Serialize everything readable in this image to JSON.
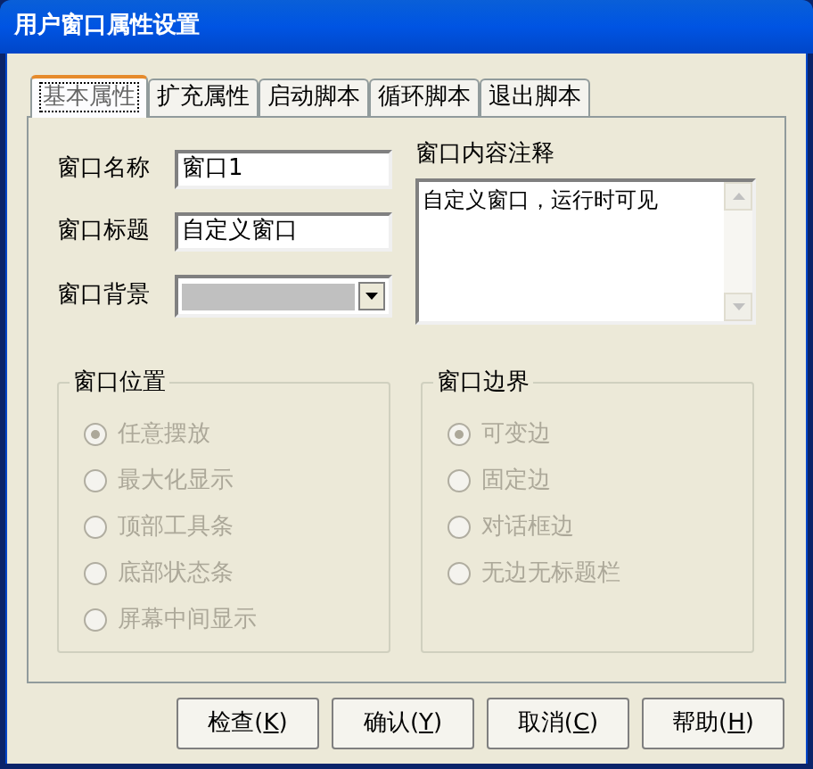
{
  "window": {
    "title": "用户窗口属性设置"
  },
  "tabs": [
    {
      "label": "基本属性",
      "selected": true
    },
    {
      "label": "扩充属性",
      "selected": false
    },
    {
      "label": "启动脚本",
      "selected": false
    },
    {
      "label": "循环脚本",
      "selected": false
    },
    {
      "label": "退出脚本",
      "selected": false
    }
  ],
  "fields": [
    {
      "label": "窗口名称",
      "kind": "text",
      "value": "窗口1"
    },
    {
      "label": "窗口标题",
      "kind": "text",
      "value": "自定义窗口"
    },
    {
      "label": "窗口背景",
      "kind": "color",
      "color": "#c0c0c0"
    }
  ],
  "comment": {
    "label": "窗口内容注释",
    "value": "自定义窗口，运行时可见"
  },
  "groups": [
    {
      "title": "窗口位置",
      "disabled": true,
      "options": [
        {
          "label": "任意摆放",
          "selected": true
        },
        {
          "label": "最大化显示",
          "selected": false
        },
        {
          "label": "顶部工具条",
          "selected": false
        },
        {
          "label": "底部状态条",
          "selected": false
        },
        {
          "label": "屏幕中间显示",
          "selected": false
        }
      ]
    },
    {
      "title": "窗口边界",
      "disabled": true,
      "options": [
        {
          "label": "可变边",
          "selected": true
        },
        {
          "label": "固定边",
          "selected": false
        },
        {
          "label": "对话框边",
          "selected": false
        },
        {
          "label": "无边无标题栏",
          "selected": false
        }
      ]
    }
  ],
  "buttons": [
    {
      "before": "检查(",
      "mnemonic": "K",
      "after": ")"
    },
    {
      "before": "确认(",
      "mnemonic": "Y",
      "after": ")"
    },
    {
      "before": "取消(",
      "mnemonic": "C",
      "after": ")"
    },
    {
      "before": "帮助(",
      "mnemonic": "H",
      "after": ")"
    }
  ]
}
